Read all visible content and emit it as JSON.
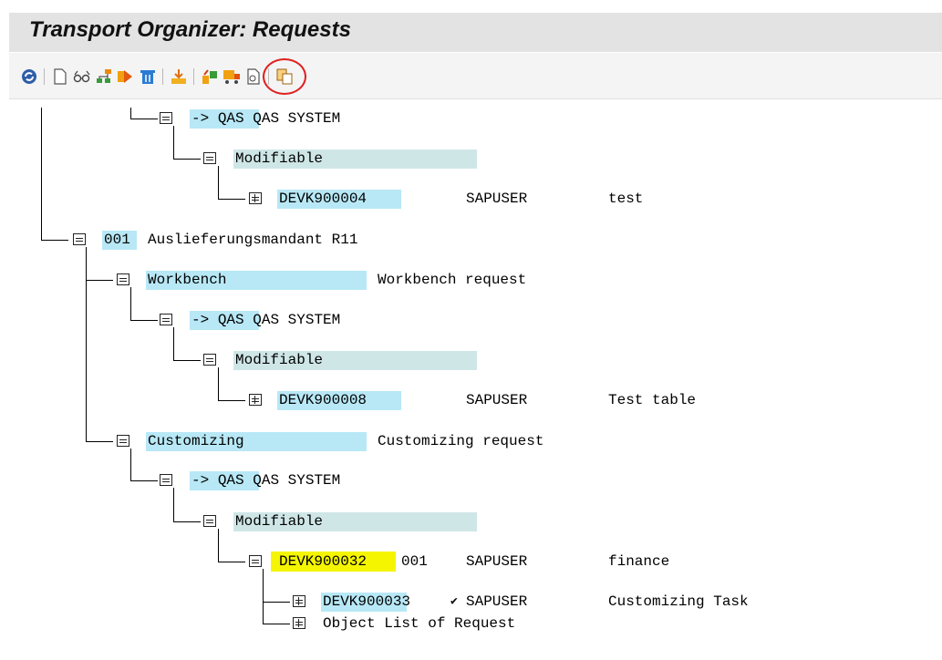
{
  "window": {
    "title": "Transport Organizer: Requests"
  },
  "toolbar": {
    "icons": [
      "refresh-icon",
      "new-document-icon",
      "glasses-icon",
      "hierarchy-icon",
      "release-icon",
      "delete-icon",
      "import-icon",
      "transport-icon",
      "truck-icon",
      "display-object-icon",
      "copy-icon"
    ]
  },
  "tree": {
    "r1": {
      "prefix": "->",
      "sys": "QAS",
      "desc": "QAS SYSTEM"
    },
    "r2": {
      "label": "Modifiable"
    },
    "r3": {
      "id": "DEVK900004",
      "user": "SAPUSER",
      "desc": "test"
    },
    "r4": {
      "num": "001",
      "desc": "Auslieferungsmandant R11"
    },
    "r5": {
      "label": "Workbench",
      "desc": "Workbench request"
    },
    "r6": {
      "prefix": "->",
      "sys": "QAS",
      "desc": "QAS SYSTEM"
    },
    "r7": {
      "label": "Modifiable"
    },
    "r8": {
      "id": "DEVK900008",
      "user": "SAPUSER",
      "desc": "Test table"
    },
    "r9": {
      "label": "Customizing",
      "desc": "Customizing request"
    },
    "r10": {
      "prefix": "->",
      "sys": "QAS",
      "desc": "QAS SYSTEM"
    },
    "r11": {
      "label": "Modifiable"
    },
    "r12": {
      "id": "DEVK900032",
      "client": "001",
      "user": "SAPUSER",
      "desc": "finance"
    },
    "r13": {
      "id": "DEVK900033",
      "check": "✔",
      "user": "SAPUSER",
      "desc": "Customizing Task"
    },
    "r14": {
      "desc": "Object List of Request"
    }
  }
}
